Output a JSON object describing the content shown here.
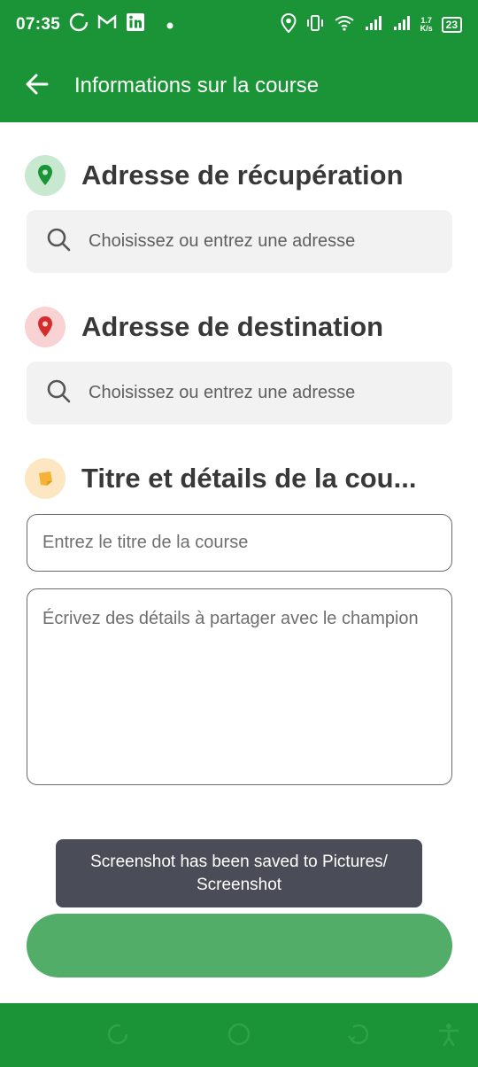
{
  "status_bar": {
    "time": "07:35",
    "network_speed_value": "1.7",
    "network_speed_unit": "K/s",
    "battery": "23",
    "icons": [
      "circle-outline-icon",
      "gmail-icon",
      "linkedin-icon",
      "dot-icon",
      "location-icon",
      "vibrate-icon",
      "wifi-icon",
      "signal-icon",
      "signal-icon",
      "battery-icon"
    ]
  },
  "toolbar": {
    "title": "Informations sur la course",
    "back_icon": "arrow-left-icon"
  },
  "pickup": {
    "title": "Adresse de récupération",
    "search_placeholder": "Choisissez ou entrez une adresse",
    "icon": "location-pin-icon",
    "icon_color": "#1a9436",
    "icon_bg": "#c9e8d0"
  },
  "destination": {
    "title": "Adresse de destination",
    "search_placeholder": "Choisissez ou entrez une adresse",
    "icon": "location-pin-icon",
    "icon_color": "#d62b2b",
    "icon_bg": "#f9d3d3"
  },
  "details": {
    "title": "Titre et détails de la cou...",
    "title_placeholder": "Entrez le titre de la course",
    "details_placeholder": "Écrivez des détails à partager avec le champion",
    "icon": "note-icon",
    "icon_color": "#f5b335",
    "icon_bg": "#fde6c2"
  },
  "toast": {
    "message": "Screenshot has been saved to  Pictures/ Screenshot"
  },
  "submit_button": {
    "label": "",
    "color": "#52ad68"
  },
  "colors": {
    "primary": "#1a9436"
  },
  "nav_bar": {
    "icons": [
      "recents-icon",
      "home-icon",
      "back-icon",
      "accessibility-icon"
    ]
  }
}
